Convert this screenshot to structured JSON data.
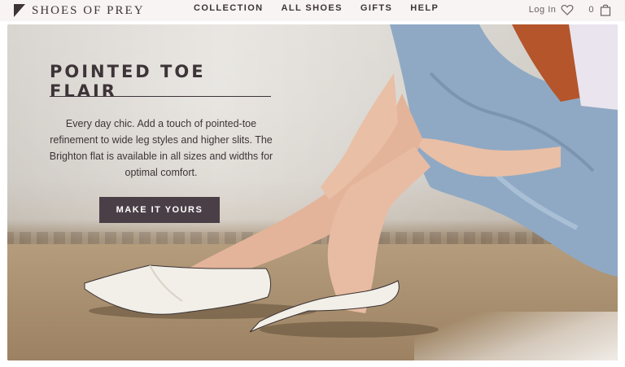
{
  "brand": {
    "name": "SHOES OF PREY"
  },
  "nav": {
    "items": [
      {
        "label": "COLLECTION"
      },
      {
        "label": "ALL SHOES"
      },
      {
        "label": "GIFTS"
      },
      {
        "label": "HELP"
      }
    ],
    "login_label": "Log In",
    "cart_count": "0"
  },
  "hero": {
    "headline": "POINTED TOE FLAIR",
    "body": "Every day chic. Add a touch of pointed-toe refinement to wide leg styles and higher slits. The Brighton flat is available in all sizes and widths for optimal comfort.",
    "cta_label": "MAKE IT YOURS"
  },
  "colors": {
    "primary": "#3d3438",
    "cta_background": "#4b3f47",
    "nav_background": "#f7f4f3"
  },
  "icons": {
    "logo": "logo-mark-icon",
    "wishlist": "heart-icon",
    "cart": "shopping-bag-icon"
  }
}
